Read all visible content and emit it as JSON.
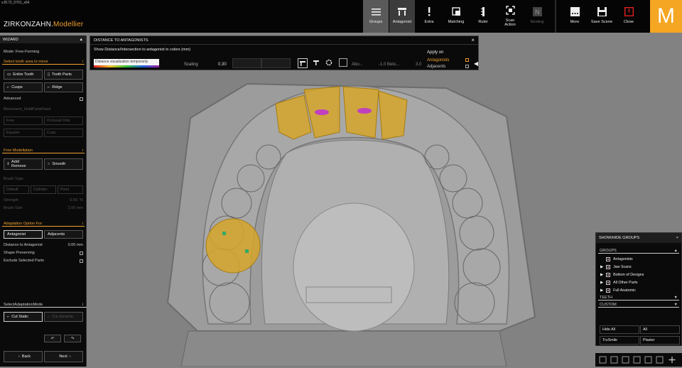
{
  "app": {
    "version": "v.8172_0701_x64",
    "title_part1": "ZIRKONZAHN.",
    "title_part2": "Modellier",
    "logo_letter": "M"
  },
  "toolbar": {
    "groups": "Groups",
    "antagonist": "Antagonist",
    "extra": "Extra",
    "matching": "Matching",
    "ruler": "Ruler",
    "scan_action": "Scan Action",
    "nesting": "Nesting",
    "more": "More",
    "save_scene": "Save Scene",
    "close": "Close"
  },
  "wizard": {
    "title": "WIZARD",
    "mode": "Mode: Free-Forming",
    "select_area": "Select tooth area to move",
    "entire_tooth": "Entire Tooth",
    "tooth_parts": "Tooth Parts",
    "cusps": "Cusps",
    "ridge": "Ridge",
    "advanced": "Advanced",
    "movement": "Movement_HoldPartsFixed",
    "free": "Free",
    "occlusal_only": "Occlusal Only",
    "equator": "Equator",
    "cusp": "Cusp",
    "free_modellation": "Free Modellation",
    "add_remove": "Add/ Remove",
    "smooth": "Smooth",
    "brush_type": "Brush Type",
    "default": "Default",
    "cylinder": "Cylinder",
    "point": "Point",
    "strength": "Strength",
    "strength_val": "0.50",
    "strength_unit": "%",
    "brush_size": "Brush Size",
    "brush_size_val": "2.00",
    "brush_size_unit": "mm",
    "adaptation": "Adaptation Option For:",
    "antagonist": "Antagonist",
    "adjacents": "Adjacents",
    "dist_to_antagonist": "Distance to Antagonist",
    "dist_val": "0.00",
    "dist_unit": "mm",
    "shape_preserving": "Shape Preserving",
    "exclude_selected": "Exclude Selected Parts",
    "select_adaptation": "SelectAdaptationMode",
    "cut_static": "Cut Static",
    "cut_dynamic": "Cut dynamic",
    "back": "Back",
    "next": "Next"
  },
  "dialog": {
    "title": "DISTANCE TO ANTAGONISTS",
    "show_distance": "Show Distance/Intersection to antagonist in colors (mm)",
    "disabled_msg": "Distance visualization temporarily disabled",
    "scaling": "Scaling",
    "scaling_val": "0.30",
    "above": "Abo...",
    "min_val": "-1.0",
    "below": "Belo...",
    "max_val": "3.0",
    "apply_on": "Apply on",
    "antagonists": "Antagonists",
    "adjacents": "Adjacents"
  },
  "groups_panel": {
    "title": "SHOW/HIDE GROUPS",
    "groups": "GROUPS",
    "items": [
      "Antagonists",
      "Jaw Scans",
      "Bottom of Designs",
      "All Other Parts",
      "Full Anatomic"
    ],
    "teeth": "TEETH",
    "custom": "CUSTOM",
    "hide_all": "Hide All",
    "all": "All",
    "trusmile": "TruSmile",
    "plaster": "Plaster"
  },
  "colors": {
    "accent": "#f0a030",
    "logo": "#f5a623",
    "close_red": "#e02020",
    "tooth_yellow": "#d6a52a"
  }
}
